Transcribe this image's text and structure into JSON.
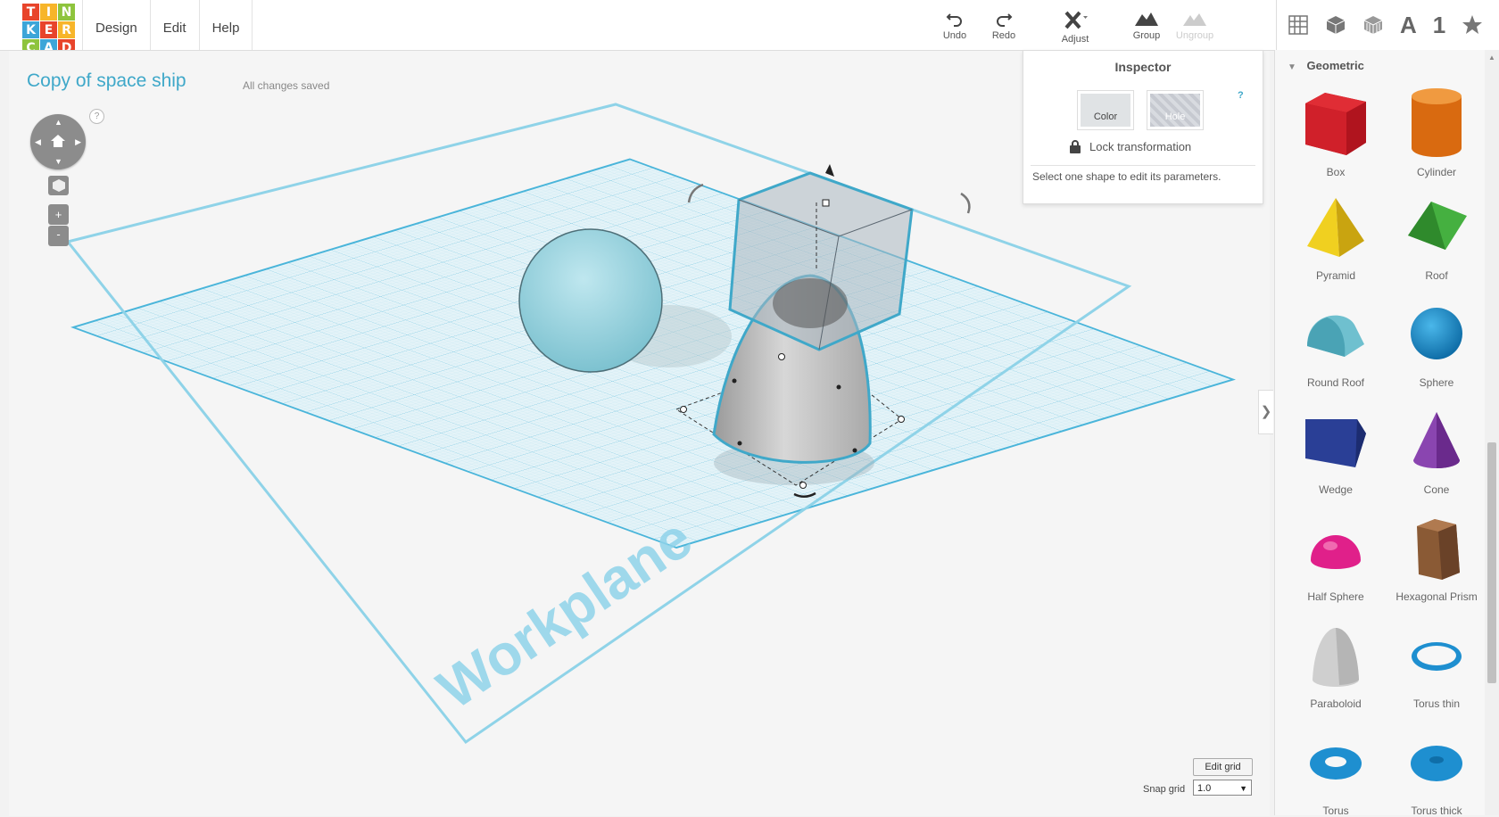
{
  "logo": {
    "letters": [
      "T",
      "I",
      "N",
      "K",
      "E",
      "R",
      "C",
      "A",
      "D"
    ],
    "colors": [
      "#e8442b",
      "#f7b52a",
      "#8ec43d",
      "#3ca5d8",
      "#e8442b",
      "#f7b52a",
      "#8ec43d",
      "#3ca5d8",
      "#e8442b"
    ]
  },
  "menu": {
    "design": "Design",
    "edit": "Edit",
    "help": "Help"
  },
  "toolbar": {
    "undo": "Undo",
    "redo": "Redo",
    "adjust": "Adjust",
    "group": "Group",
    "ungroup": "Ungroup"
  },
  "view_tools": {
    "text": "A",
    "number": "1"
  },
  "project": {
    "title": "Copy of space ship",
    "status": "All changes saved"
  },
  "nav": {
    "help": "?",
    "zoom_in": "+",
    "zoom_out": "-"
  },
  "inspector": {
    "title": "Inspector",
    "color_label": "Color",
    "hole_label": "Hole",
    "help": "?",
    "lock_label": "Lock transformation",
    "message": "Select one shape to edit its parameters."
  },
  "workplane": {
    "label": "Workplane"
  },
  "grid": {
    "edit_label": "Edit grid",
    "snap_label": "Snap grid",
    "snap_value": "1.0"
  },
  "sidebar": {
    "category": "Geometric",
    "shapes": [
      {
        "name": "Box",
        "color": "#d0202a"
      },
      {
        "name": "Cylinder",
        "color": "#e9791a"
      },
      {
        "name": "Pyramid",
        "color": "#e6c51b"
      },
      {
        "name": "Roof",
        "color": "#3a9a35"
      },
      {
        "name": "Round Roof",
        "color": "#5fb8c9"
      },
      {
        "name": "Sphere",
        "color": "#1e8fd0"
      },
      {
        "name": "Wedge",
        "color": "#273a8c"
      },
      {
        "name": "Cone",
        "color": "#7c3aa0"
      },
      {
        "name": "Half Sphere",
        "color": "#e0208a"
      },
      {
        "name": "Hexagonal Prism",
        "color": "#8a5a35"
      },
      {
        "name": "Paraboloid",
        "color": "#d5d5d5"
      },
      {
        "name": "Torus thin",
        "color": "#1e8fd0"
      },
      {
        "name": "Torus",
        "color": "#1e8fd0"
      },
      {
        "name": "Torus thick",
        "color": "#1e8fd0"
      }
    ]
  }
}
